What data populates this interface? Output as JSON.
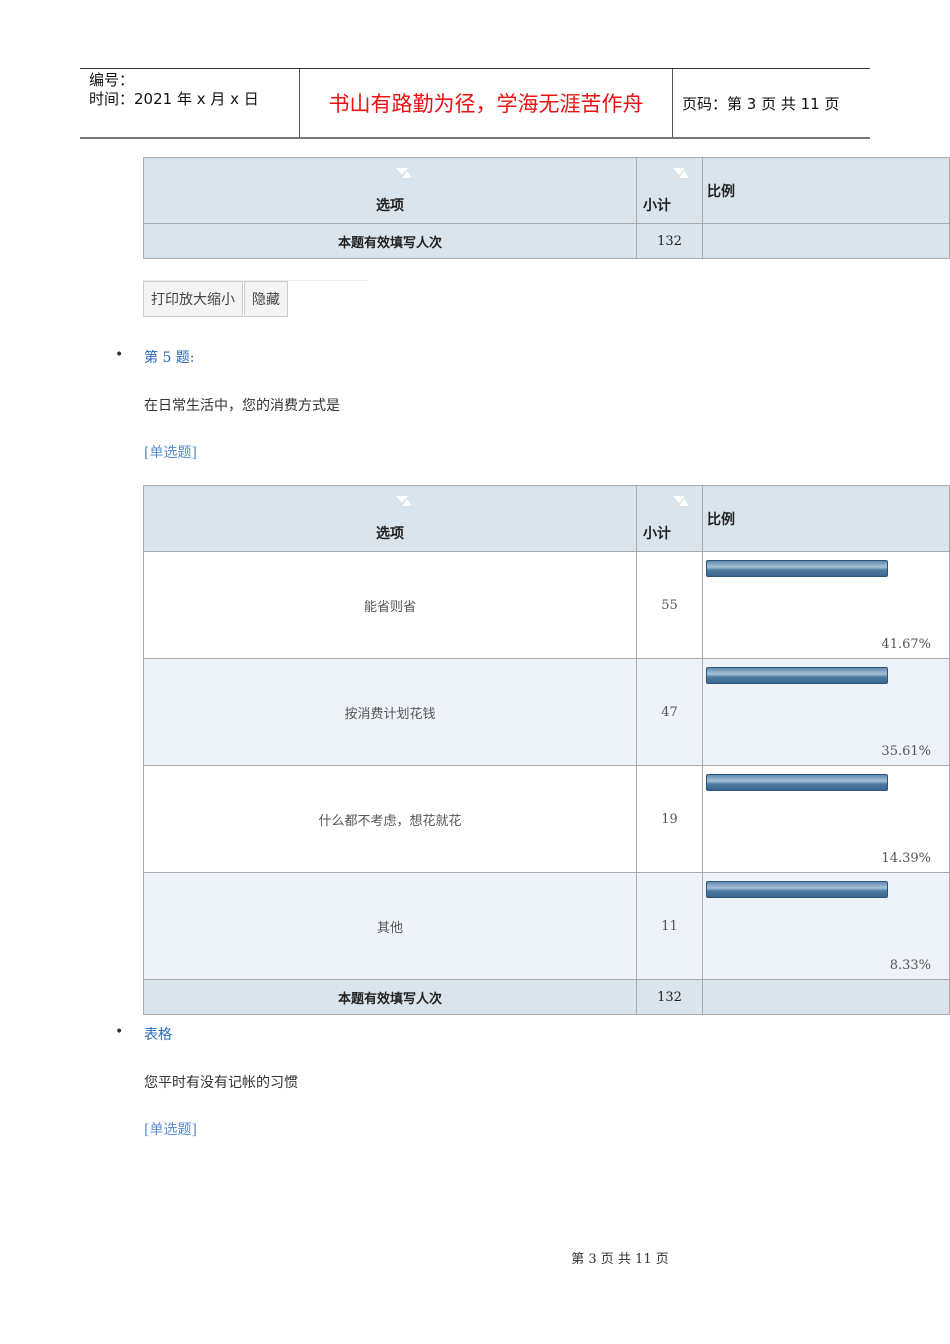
{
  "header": {
    "id_label": "编号：",
    "time_label": "时间：2021 年 x 月 x 日",
    "motto": "书山有路勤为径，学海无涯苦作舟",
    "page_label": "页码：第 3 页  共 11 页"
  },
  "table_headers": {
    "option": "选项",
    "count": "小计",
    "ratio": "比例"
  },
  "prev_table": {
    "summary_label": "本题有效填写人次",
    "summary_count": "132"
  },
  "buttons": {
    "print": "打印放大缩小",
    "hide": "隐藏"
  },
  "q5": {
    "title": "第 5 题:",
    "question": "在日常生活中，您的消费方式是",
    "type": "[单选题]",
    "rows": [
      {
        "option": "能省则省",
        "count": "55",
        "percent": "41.67%",
        "value": 41.67
      },
      {
        "option": "按消费计划花钱",
        "count": "47",
        "percent": "35.61%",
        "value": 35.61
      },
      {
        "option": "什么都不考虑，想花就花",
        "count": "19",
        "percent": "14.39%",
        "value": 14.39
      },
      {
        "option": "其他",
        "count": "11",
        "percent": "8.33%",
        "value": 8.33
      }
    ],
    "summary_label": "本题有效填写人次",
    "summary_count": "132"
  },
  "q6": {
    "title": "表格",
    "question": "您平时有没有记帐的习惯",
    "type": "[单选题]"
  },
  "footer": "第 3 页 共 11 页"
}
